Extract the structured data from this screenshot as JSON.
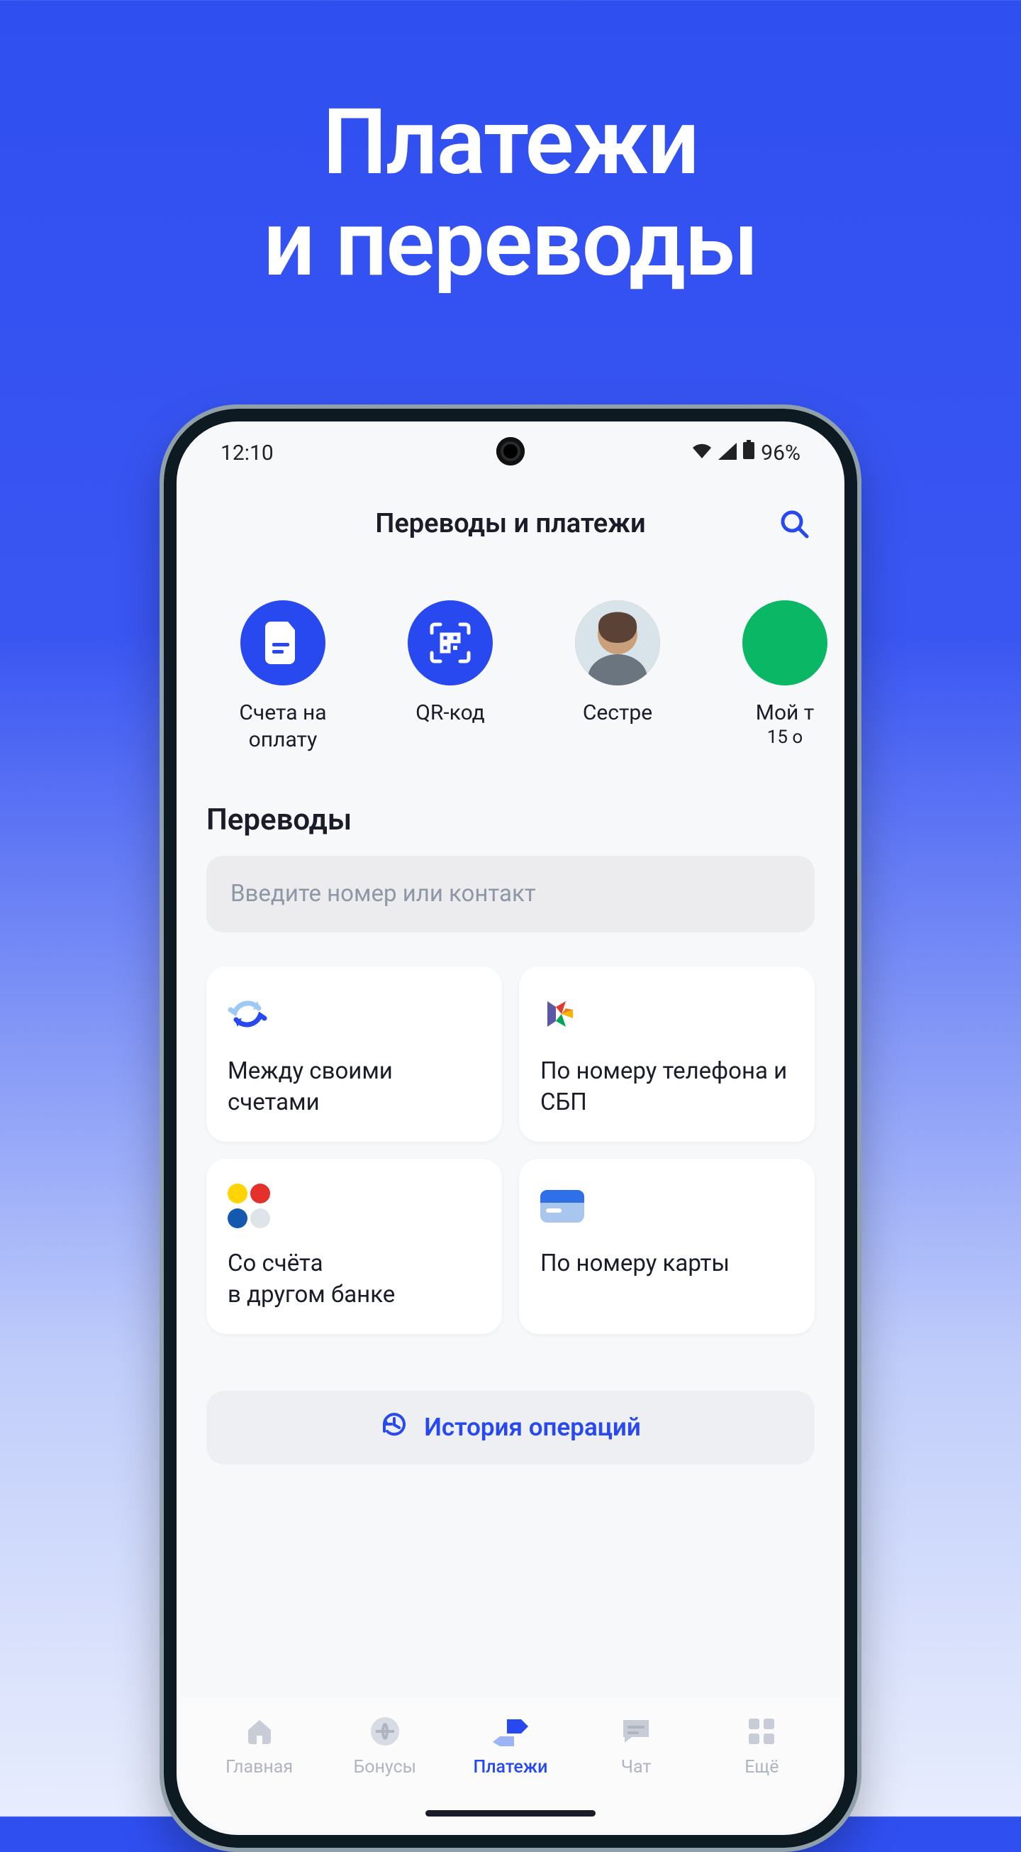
{
  "promo": {
    "line1": "Платежи",
    "line2": "и переводы"
  },
  "status": {
    "time": "12:10",
    "battery": "96%"
  },
  "header": {
    "title": "Переводы и платежи"
  },
  "quick": {
    "items": [
      {
        "label": "Счета на\nоплату"
      },
      {
        "label": "QR-код"
      },
      {
        "label": "Сестре"
      },
      {
        "label": "Мой т",
        "sub": "15 о"
      }
    ]
  },
  "transfers": {
    "section_title": "Переводы",
    "input_placeholder": "Введите номер или контакт",
    "tiles": [
      {
        "label": "Между своими счетами"
      },
      {
        "label": "По номеру телефона и СБП"
      },
      {
        "label": "Со счёта\nв другом банке"
      },
      {
        "label": "По номеру карты"
      }
    ],
    "history_label": "История операций"
  },
  "nav": {
    "items": [
      {
        "label": "Главная"
      },
      {
        "label": "Бонусы"
      },
      {
        "label": "Платежи"
      },
      {
        "label": "Чат"
      },
      {
        "label": "Ещё"
      }
    ]
  }
}
